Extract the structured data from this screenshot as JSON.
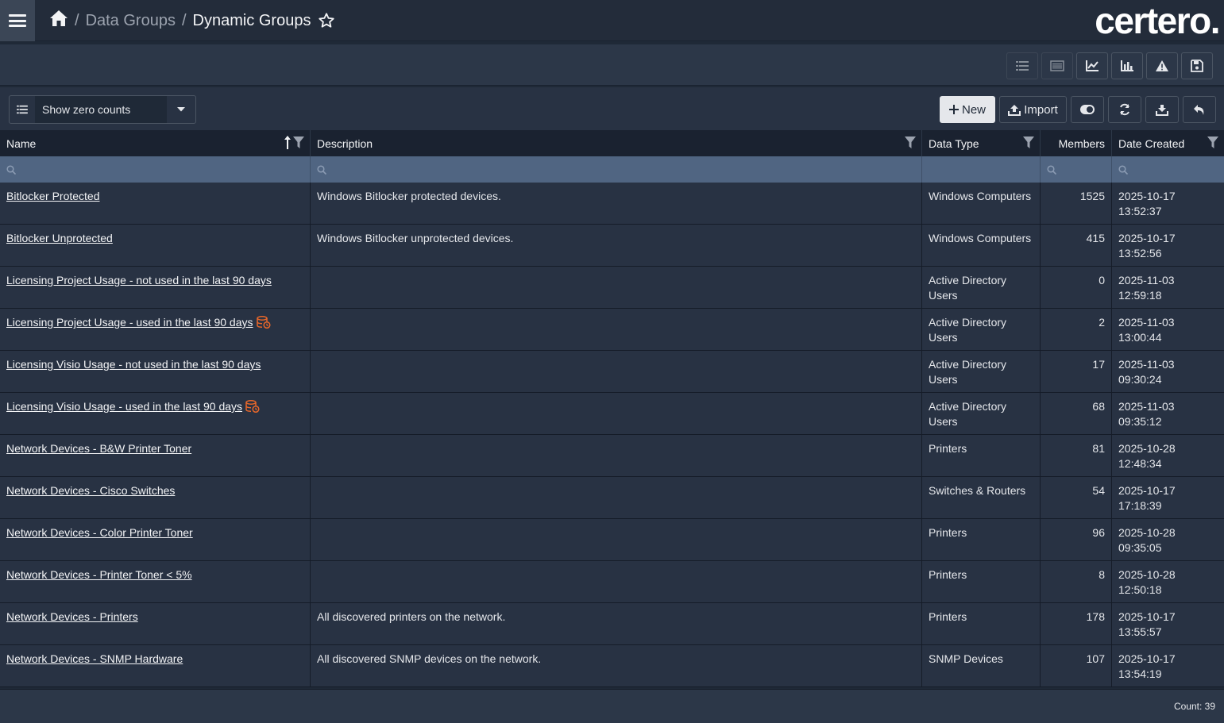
{
  "breadcrumb": {
    "home_icon": "home-icon",
    "items": [
      "Data Groups",
      "Dynamic Groups"
    ],
    "favorite_icon": "star-icon"
  },
  "brand": {
    "logo_text": "certero."
  },
  "toolbar": {
    "icons": [
      "list-icon",
      "table-icon",
      "line-chart-icon",
      "bar-chart-icon",
      "warning-icon",
      "save-icon"
    ]
  },
  "filter": {
    "icon": "list-icon",
    "label": "Show zero counts",
    "caret_icon": "caret-down-icon"
  },
  "actions": {
    "new_label": "New",
    "import_label": "Import",
    "icons": [
      "plus-icon",
      "upload-icon",
      "toggle-icon",
      "refresh-icon",
      "download-icon",
      "undo-icon"
    ]
  },
  "table": {
    "columns": [
      "Name",
      "Description",
      "Data Type",
      "Members",
      "Date Created"
    ],
    "sort": {
      "column": "Name",
      "direction": "ascending"
    },
    "rows": [
      {
        "name": "Bitlocker Protected",
        "description": "Windows Bitlocker protected devices.",
        "data_type": "Windows Computers",
        "members": "1525",
        "date": "2025-10-17",
        "time": "13:52:37",
        "flag": false
      },
      {
        "name": "Bitlocker Unprotected",
        "description": "Windows Bitlocker unprotected devices.",
        "data_type": "Windows Computers",
        "members": "415",
        "date": "2025-10-17",
        "time": "13:52:56",
        "flag": false
      },
      {
        "name": "Licensing Project Usage - not used in the last 90 days",
        "description": "",
        "data_type": "Active Directory Users",
        "members": "0",
        "date": "2025-11-03",
        "time": "12:59:18",
        "flag": false
      },
      {
        "name": "Licensing Project Usage - used in the last 90 days",
        "description": "",
        "data_type": "Active Directory Users",
        "members": "2",
        "date": "2025-11-03",
        "time": "13:00:44",
        "flag": true
      },
      {
        "name": "Licensing Visio Usage - not used in the last 90 days",
        "description": "",
        "data_type": "Active Directory Users",
        "members": "17",
        "date": "2025-11-03",
        "time": "09:30:24",
        "flag": false
      },
      {
        "name": "Licensing Visio Usage - used in the last 90 days",
        "description": "",
        "data_type": "Active Directory Users",
        "members": "68",
        "date": "2025-11-03",
        "time": "09:35:12",
        "flag": true
      },
      {
        "name": "Network Devices - B&W Printer Toner",
        "description": "",
        "data_type": "Printers",
        "members": "81",
        "date": "2025-10-28",
        "time": "12:48:34",
        "flag": false
      },
      {
        "name": "Network Devices - Cisco Switches",
        "description": "",
        "data_type": "Switches & Routers",
        "members": "54",
        "date": "2025-10-17",
        "time": "17:18:39",
        "flag": false
      },
      {
        "name": "Network Devices - Color Printer Toner",
        "description": "",
        "data_type": "Printers",
        "members": "96",
        "date": "2025-10-28",
        "time": "09:35:05",
        "flag": false
      },
      {
        "name": "Network Devices - Printer Toner < 5%",
        "description": "",
        "data_type": "Printers",
        "members": "8",
        "date": "2025-10-28",
        "time": "12:50:18",
        "flag": false
      },
      {
        "name": "Network Devices - Printers",
        "description": "All discovered printers on the network.",
        "data_type": "Printers",
        "members": "178",
        "date": "2025-10-17",
        "time": "13:55:57",
        "flag": false
      },
      {
        "name": "Network Devices - SNMP Hardware",
        "description": "All discovered SNMP devices on the network.",
        "data_type": "SNMP Devices",
        "members": "107",
        "date": "2025-10-17",
        "time": "13:54:19",
        "flag": false
      }
    ]
  },
  "footer": {
    "count_text": "Count: 39"
  },
  "colors": {
    "flag_icon": "#e8672a",
    "header_bg": "#1a2230",
    "search_row_bg": "#506582",
    "row_bg": "#283243"
  }
}
